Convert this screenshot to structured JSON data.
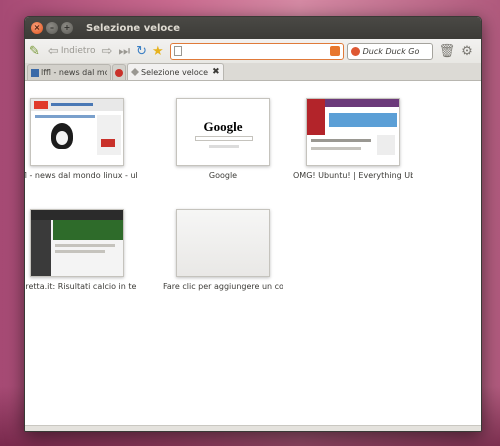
{
  "window": {
    "title": "Selezione veloce"
  },
  "toolbar": {
    "back_label": "Indietro",
    "address_value": "",
    "search_engine": "Duck Duck Go"
  },
  "tabs": [
    {
      "label": "lffl - news dal mo...",
      "active": false
    },
    {
      "label": "Selezione veloce",
      "active": true
    }
  ],
  "speed_dial": [
    {
      "caption": "lffl - news dal mondo linux - ubuntu"
    },
    {
      "caption": "Google",
      "thumb_text": "Google"
    },
    {
      "caption": "OMG! Ubuntu! | Everything Ubuntu..."
    },
    {
      "caption": "Diretta.it: Risultati calcio in tempo..."
    },
    {
      "caption": "Fare clic per aggiungere un colleg..."
    }
  ],
  "colors": {
    "titlebar": "#3c3b37",
    "close_button": "#e2531d",
    "address_border": "#e07a3a",
    "omg_purple": "#6b3a7a"
  }
}
